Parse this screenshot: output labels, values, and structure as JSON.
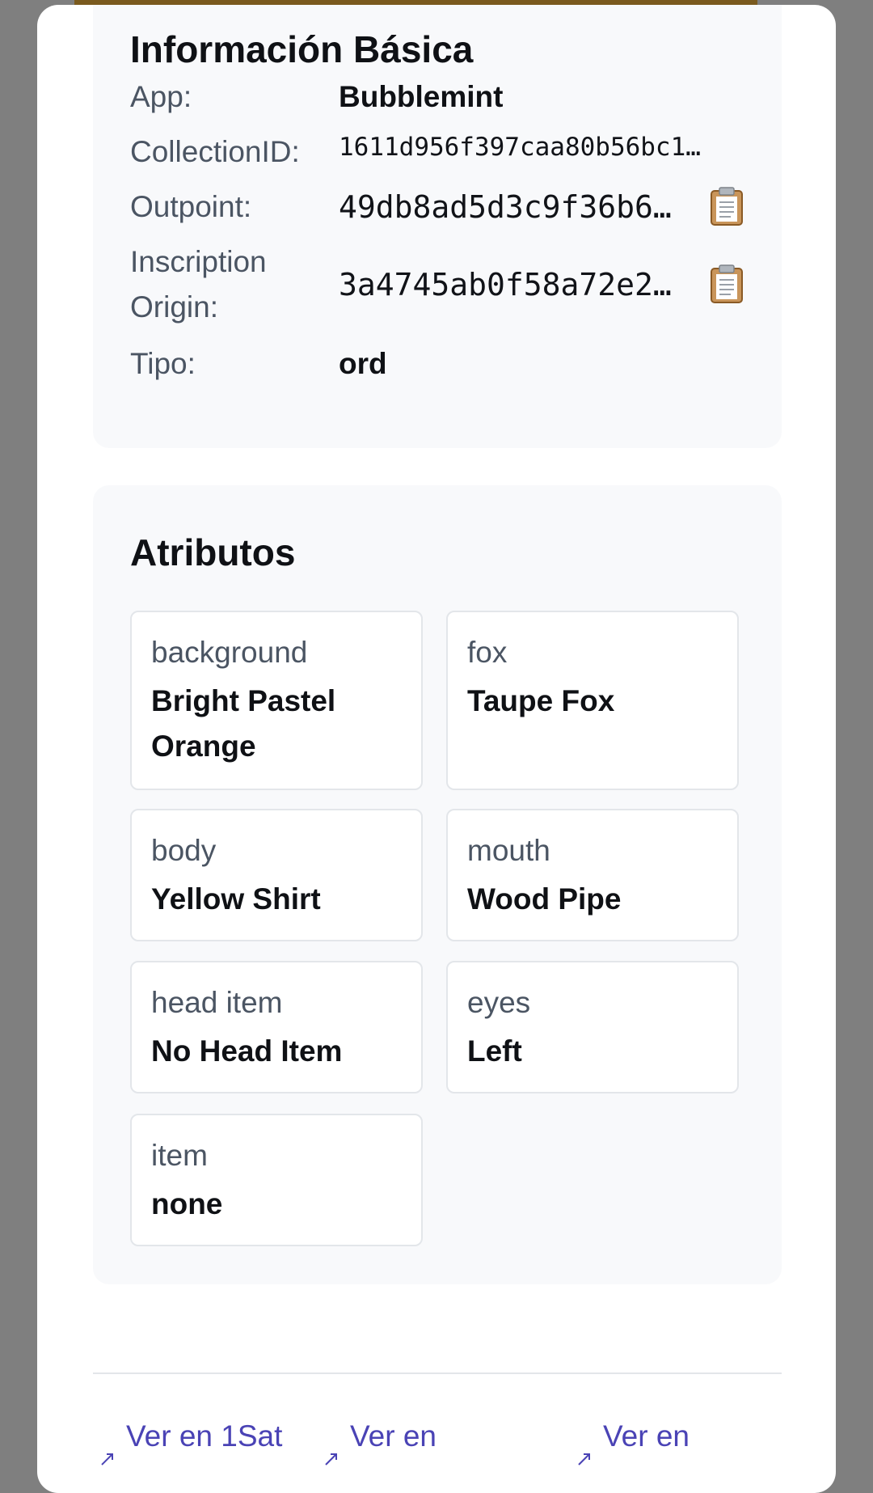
{
  "basic_info": {
    "title": "Información Básica",
    "rows": [
      {
        "label": "App:",
        "value": "Bubblemint"
      },
      {
        "label": "CollectionID:",
        "value": "1611d956f397caa80b56bc1…"
      },
      {
        "label": "Outpoint:",
        "value": "49db8ad5d3c9f36b6…"
      },
      {
        "label": "Inscription Origin:",
        "label_line1": "Inscription",
        "label_line2": "Origin:",
        "value": "3a4745ab0f58a72e2…"
      },
      {
        "label": "Tipo:",
        "value": "ord"
      }
    ],
    "copy_icon": "clipboard-icon"
  },
  "attributes": {
    "title": "Atributos",
    "items": [
      {
        "key": "background",
        "value": "Bright Pastel Orange"
      },
      {
        "key": "fox",
        "value": "Taupe Fox"
      },
      {
        "key": "body",
        "value": "Yellow Shirt"
      },
      {
        "key": "mouth",
        "value": "Wood Pipe"
      },
      {
        "key": "head item",
        "value": "No Head Item"
      },
      {
        "key": "eyes",
        "value": "Left"
      },
      {
        "key": "item",
        "value": "none"
      }
    ]
  },
  "footer": {
    "links": [
      {
        "label": "Ver en 1Sat"
      },
      {
        "label": "Ver en"
      },
      {
        "label": "Ver en"
      }
    ],
    "link_icon": "external-link-icon"
  },
  "colors": {
    "overlay": "#7f7f7f",
    "accent_bar": "#7a5a1e",
    "link": "#4a43b5",
    "card_bg": "#f8f9fb",
    "border": "#e3e6ea"
  }
}
